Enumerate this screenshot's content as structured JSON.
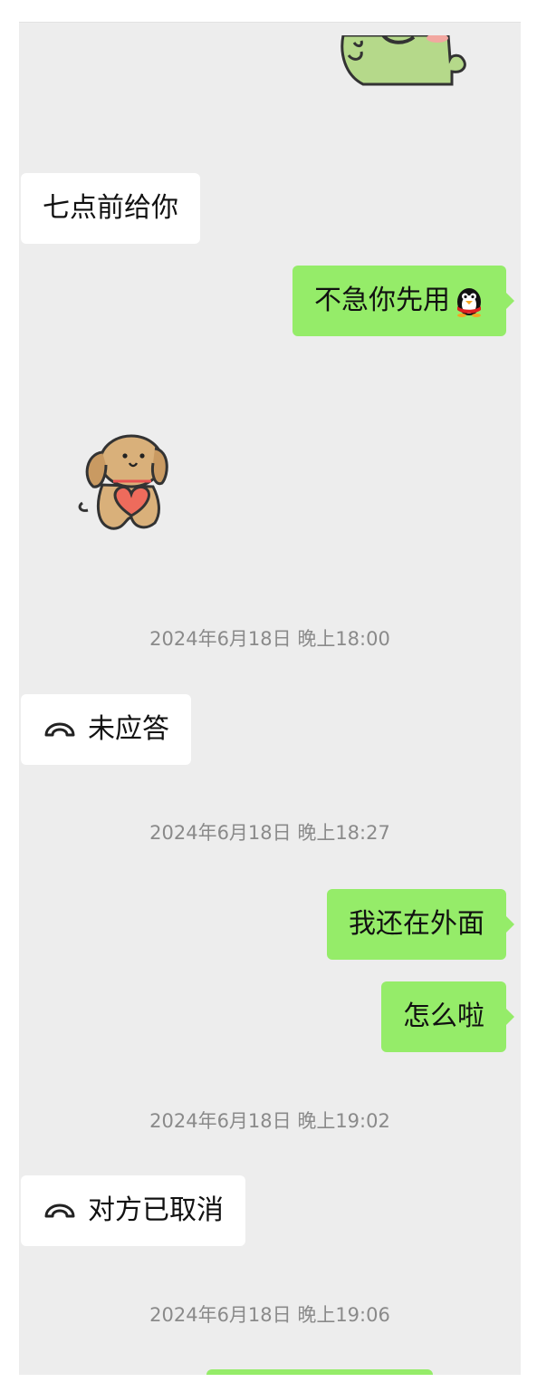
{
  "messages": {
    "m1": "七点前给你",
    "m2": "不急你先用",
    "m3_call": "未应答",
    "m4": "我还在外面",
    "m5": "怎么啦",
    "m6_call": "对方已取消"
  },
  "timestamps": {
    "t1": "2024年6月18日 晚上18:00",
    "t2": "2024年6月18日 晚上18:27",
    "t3": "2024年6月18日 晚上19:02",
    "t4": "2024年6月18日 晚上19:06"
  },
  "icons": {
    "call": "phone-hangup-icon",
    "emoji": "penguin-emoji-icon",
    "sticker_top": "dinosaur-sticker",
    "sticker_dog": "puppy-heart-sticker"
  },
  "colors": {
    "chat_bg": "#ededed",
    "outgoing_bubble": "#95ec69",
    "incoming_bubble": "#ffffff",
    "timestamp": "#8a8a8a"
  }
}
